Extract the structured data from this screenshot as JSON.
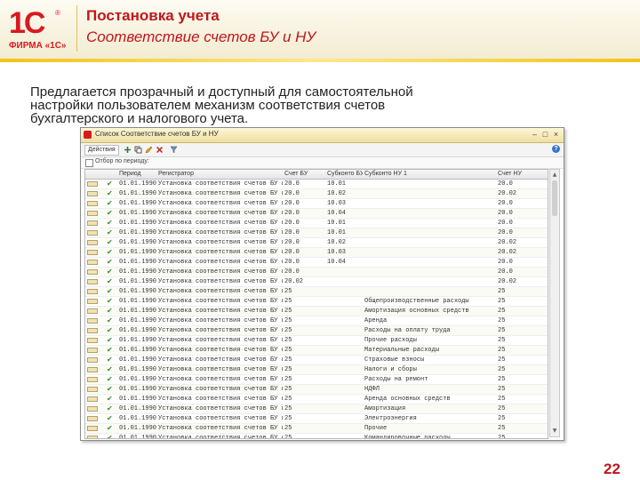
{
  "header": {
    "logo_mark": "1С",
    "logo_registered": "®",
    "logo_firm": "ФИРМА «1С»",
    "title": "Постановка учета",
    "subtitle": "Соответствие счетов БУ и НУ"
  },
  "lead_text": "Предлагается прозрачный и доступный для самостоятельной настройки пользователем механизм соответствия счетов бухгалтерского и налогового учета.",
  "window": {
    "title": "Список Соответствие счетов БУ и НУ",
    "actions_label": "Действия",
    "filter_label": "Отбор по периоду:",
    "columns": [
      "Период",
      "Регистратор",
      "Счет БУ",
      "Субконто БУ 1",
      "Субконто НУ 1",
      "Счет НУ"
    ],
    "rows": [
      {
        "period": "01.01.1990",
        "doc": "Установка соответствия счетов БУ и НУ",
        "bu": "20.0",
        "sub_bu": "10.01",
        "sub_nu": "",
        "nu": "20.0"
      },
      {
        "period": "01.01.1990",
        "doc": "Установка соответствия счетов БУ и НУ",
        "bu": "20.0",
        "sub_bu": "10.02",
        "sub_nu": "",
        "nu": "20.02"
      },
      {
        "period": "01.01.1990",
        "doc": "Установка соответствия счетов БУ и НУ",
        "bu": "20.0",
        "sub_bu": "10.03",
        "sub_nu": "",
        "nu": "20.0"
      },
      {
        "period": "01.01.1990",
        "doc": "Установка соответствия счетов БУ и НУ",
        "bu": "20.0",
        "sub_bu": "10.04",
        "sub_nu": "",
        "nu": "20.0"
      },
      {
        "period": "01.01.1990",
        "doc": "Установка соответствия счетов БУ и НУ",
        "bu": "20.0",
        "sub_bu": "10.01",
        "sub_nu": "",
        "nu": "20.0"
      },
      {
        "period": "01.01.1990",
        "doc": "Установка соответствия счетов БУ и НУ",
        "bu": "20.0",
        "sub_bu": "10.01",
        "sub_nu": "",
        "nu": "20.0"
      },
      {
        "period": "01.01.1990",
        "doc": "Установка соответствия счетов БУ и НУ",
        "bu": "20.0",
        "sub_bu": "10.02",
        "sub_nu": "",
        "nu": "20.02"
      },
      {
        "period": "01.01.1990",
        "doc": "Установка соответствия счетов БУ и НУ",
        "bu": "20.0",
        "sub_bu": "10.03",
        "sub_nu": "",
        "nu": "20.02"
      },
      {
        "period": "01.01.1990",
        "doc": "Установка соответствия счетов БУ и НУ",
        "bu": "20.0",
        "sub_bu": "10.04",
        "sub_nu": "",
        "nu": "20.0"
      },
      {
        "period": "01.01.1990",
        "doc": "Установка соответствия счетов БУ и НУ",
        "bu": "20.0",
        "sub_bu": "",
        "sub_nu": "",
        "nu": "20.0"
      },
      {
        "period": "01.01.1990",
        "doc": "Установка соответствия счетов БУ и НУ",
        "bu": "20.02",
        "sub_bu": "",
        "sub_nu": "",
        "nu": "20.02"
      },
      {
        "period": "01.01.1990",
        "doc": "Установка соответствия счетов БУ и НУ",
        "bu": "25",
        "sub_bu": "",
        "sub_nu": "",
        "nu": "25"
      },
      {
        "period": "01.01.1990",
        "doc": "Установка соответствия счетов БУ и НУ",
        "bu": "25",
        "sub_bu": "",
        "sub_nu": "Общепроизводственные расходы",
        "nu": "25"
      },
      {
        "period": "01.01.1990",
        "doc": "Установка соответствия счетов БУ и НУ",
        "bu": "25",
        "sub_bu": "",
        "sub_nu": "Амортизация основных средств",
        "nu": "25"
      },
      {
        "period": "01.01.1990",
        "doc": "Установка соответствия счетов БУ и НУ",
        "bu": "25",
        "sub_bu": "",
        "sub_nu": "Аренда",
        "nu": "25"
      },
      {
        "period": "01.01.1990",
        "doc": "Установка соответствия счетов БУ и НУ",
        "bu": "25",
        "sub_bu": "",
        "sub_nu": "Расходы на оплату труда",
        "nu": "25"
      },
      {
        "period": "01.01.1990",
        "doc": "Установка соответствия счетов БУ и НУ",
        "bu": "25",
        "sub_bu": "",
        "sub_nu": "Прочие расходы",
        "nu": "25"
      },
      {
        "period": "01.01.1990",
        "doc": "Установка соответствия счетов БУ и НУ",
        "bu": "25",
        "sub_bu": "",
        "sub_nu": "Материальные расходы",
        "nu": "25"
      },
      {
        "period": "01.01.1990",
        "doc": "Установка соответствия счетов БУ и НУ",
        "bu": "25",
        "sub_bu": "",
        "sub_nu": "Страховые взносы",
        "nu": "25"
      },
      {
        "period": "01.01.1990",
        "doc": "Установка соответствия счетов БУ и НУ",
        "bu": "25",
        "sub_bu": "",
        "sub_nu": "Налоги и сборы",
        "nu": "25"
      },
      {
        "period": "01.01.1990",
        "doc": "Установка соответствия счетов БУ и НУ",
        "bu": "25",
        "sub_bu": "",
        "sub_nu": "Расходы на ремонт",
        "nu": "25"
      },
      {
        "period": "01.01.1990",
        "doc": "Установка соответствия счетов БУ и НУ",
        "bu": "25",
        "sub_bu": "",
        "sub_nu": "НДФЛ",
        "nu": "25"
      },
      {
        "period": "01.01.1990",
        "doc": "Установка соответствия счетов БУ и НУ",
        "bu": "25",
        "sub_bu": "",
        "sub_nu": "Аренда основных средств",
        "nu": "25"
      },
      {
        "period": "01.01.1990",
        "doc": "Установка соответствия счетов БУ и НУ",
        "bu": "25",
        "sub_bu": "",
        "sub_nu": "Амортизация",
        "nu": "25"
      },
      {
        "period": "01.01.1990",
        "doc": "Установка соответствия счетов БУ и НУ",
        "bu": "25",
        "sub_bu": "",
        "sub_nu": "Электроэнергия",
        "nu": "25"
      },
      {
        "period": "01.01.1990",
        "doc": "Установка соответствия счетов БУ и НУ",
        "bu": "25",
        "sub_bu": "",
        "sub_nu": "Прочие",
        "nu": "25"
      },
      {
        "period": "01.01.1990",
        "doc": "Установка соответствия счетов БУ и НУ",
        "bu": "25",
        "sub_bu": "",
        "sub_nu": "Командировочные расходы",
        "nu": "25"
      }
    ]
  },
  "page_number": "22",
  "colors": {
    "brand_red": "#c0161c",
    "accent_yellow": "#f0c418"
  },
  "icons": [
    "app-icon",
    "minimize-icon",
    "maximize-icon",
    "close-icon",
    "add-icon",
    "copy-icon",
    "edit-icon",
    "delete-icon",
    "filter-icon",
    "help-icon",
    "checkmark-icon",
    "row-document-icon"
  ]
}
